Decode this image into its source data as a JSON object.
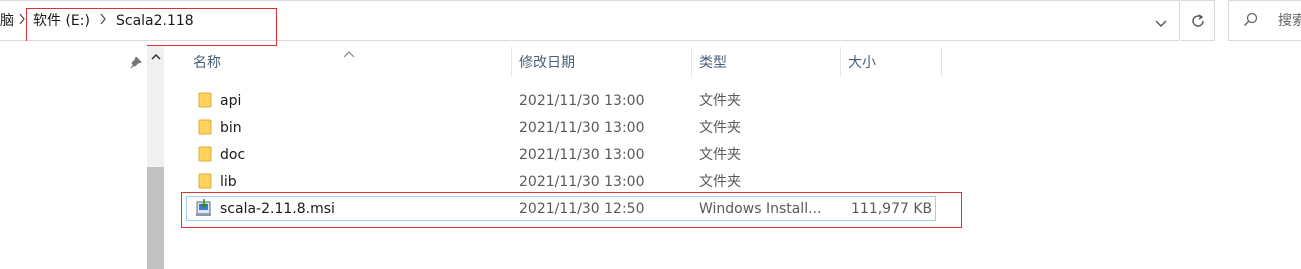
{
  "address": {
    "prefix_fragment": "脑",
    "crumbs": [
      "软件 (E:)",
      "Scala2.118"
    ]
  },
  "search": {
    "placeholder": "搜索"
  },
  "columns": {
    "name": "名称",
    "modified": "修改日期",
    "type": "类型",
    "size": "大小"
  },
  "files": [
    {
      "name": "api",
      "modified": "2021/11/30 13:00",
      "type": "文件夹",
      "size": "",
      "icon": "folder-icon"
    },
    {
      "name": "bin",
      "modified": "2021/11/30 13:00",
      "type": "文件夹",
      "size": "",
      "icon": "folder-icon"
    },
    {
      "name": "doc",
      "modified": "2021/11/30 13:00",
      "type": "文件夹",
      "size": "",
      "icon": "folder-icon"
    },
    {
      "name": "lib",
      "modified": "2021/11/30 13:00",
      "type": "文件夹",
      "size": "",
      "icon": "folder-icon"
    },
    {
      "name": "scala-2.11.8.msi",
      "modified": "2021/11/30 12:50",
      "type": "Windows Install...",
      "size": "111,977 KB",
      "icon": "msi-installer-icon"
    }
  ],
  "colors": {
    "highlight_box": "#e03030",
    "selection_border": "#99d1ff",
    "folder": "#ffd25c"
  }
}
